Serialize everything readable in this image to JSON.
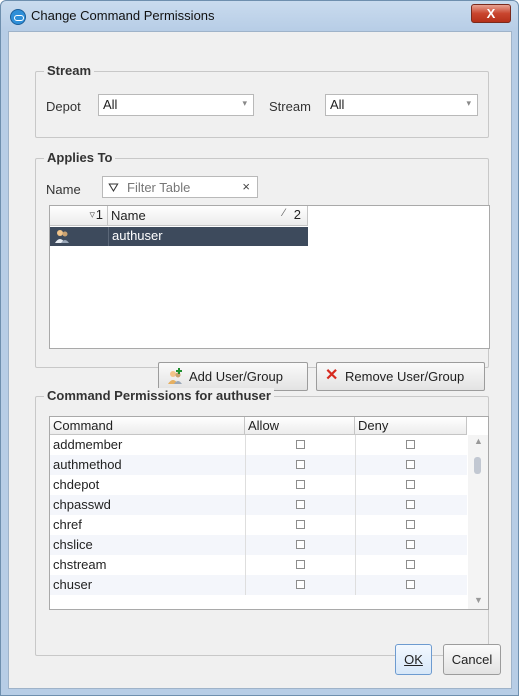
{
  "window": {
    "title": "Change Command Permissions",
    "close_label": "X"
  },
  "stream_group": {
    "title": "Stream",
    "depot_label": "Depot",
    "depot_value": "All",
    "stream_label": "Stream",
    "stream_value": "All"
  },
  "applies_to": {
    "title": "Applies To",
    "name_label": "Name",
    "filter_placeholder": "Filter Table",
    "filter_clear": "×",
    "columns": [
      {
        "label": "",
        "sort": "1"
      },
      {
        "label": "Name",
        "sort": "2"
      }
    ],
    "rows": [
      {
        "name": "authuser",
        "icon": "user-icon"
      }
    ],
    "add_button": "Add User/Group",
    "remove_button": "Remove User/Group"
  },
  "permissions": {
    "title": "Command Permissions for authuser",
    "columns": [
      "Command",
      "Allow",
      "Deny"
    ],
    "rows": [
      {
        "command": "addmember",
        "allow": false,
        "deny": false
      },
      {
        "command": "authmethod",
        "allow": false,
        "deny": false
      },
      {
        "command": "chdepot",
        "allow": false,
        "deny": false
      },
      {
        "command": "chpasswd",
        "allow": false,
        "deny": false
      },
      {
        "command": "chref",
        "allow": false,
        "deny": false
      },
      {
        "command": "chslice",
        "allow": false,
        "deny": false
      },
      {
        "command": "chstream",
        "allow": false,
        "deny": false
      },
      {
        "command": "chuser",
        "allow": false,
        "deny": false
      }
    ]
  },
  "footer": {
    "ok": "OK",
    "cancel": "Cancel"
  },
  "colors": {
    "selected_row": "#3d4a5c",
    "alt_row": "#f4f6fb",
    "close_button": "#c9452e"
  }
}
